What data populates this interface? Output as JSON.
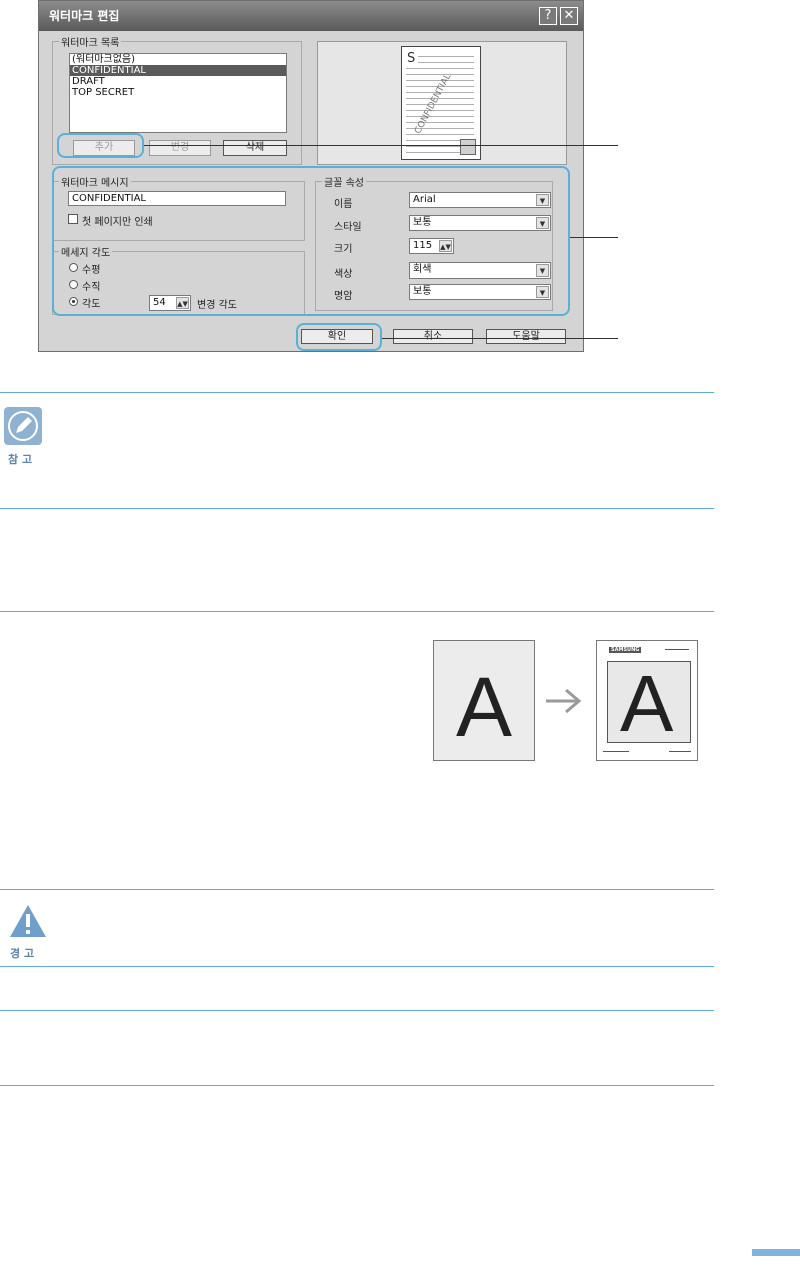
{
  "dialog": {
    "title": "워터마크 편집",
    "help_glyph": "?",
    "close_glyph": "✕",
    "watermark_list_legend": "워터마크 목록",
    "watermark_list": [
      "(워터마크없음)",
      "CONFIDENTIAL",
      "DRAFT",
      "TOP SECRET"
    ],
    "selected_index": 1,
    "add_label": "추가",
    "update_label": "변경",
    "delete_label": "삭제",
    "preview": {
      "letter": "S",
      "watermark_text": "CONFIDENTIAL"
    },
    "message_legend": "워터마크 메시지",
    "message_value": "CONFIDENTIAL",
    "first_page_only_label": "첫 페이지만 인쇄",
    "angle_legend": "메세지 각도",
    "angle_options": [
      "수평",
      "수직",
      "각도"
    ],
    "angle_selected": 2,
    "angle_value": "54",
    "angle_unit_label": "변경 각도",
    "font_legend": "글꼴 속성",
    "font_name_label": "이름",
    "font_name_value": "Arial",
    "font_style_label": "스타일",
    "font_style_value": "보통",
    "font_size_label": "크기",
    "font_size_value": "115",
    "font_color_label": "색상",
    "font_color_value": "회색",
    "font_shade_label": "명암",
    "font_shade_value": "보통",
    "ok_label": "확인",
    "cancel_label": "취소",
    "help_label": "도움말"
  },
  "note": {
    "caption": "참 고",
    "icon": "pencil-icon"
  },
  "warning": {
    "caption": "경 고",
    "icon": "warning-icon"
  },
  "illustration": {
    "before_letter": "A",
    "after_letter": "A",
    "arrow_icon": "arrow-right-icon",
    "brand": "SAMSUNG"
  },
  "colors": {
    "accent": "#5fa9d8",
    "highlight": "#5bb0d8",
    "note_icon": "#8fb2d3"
  }
}
